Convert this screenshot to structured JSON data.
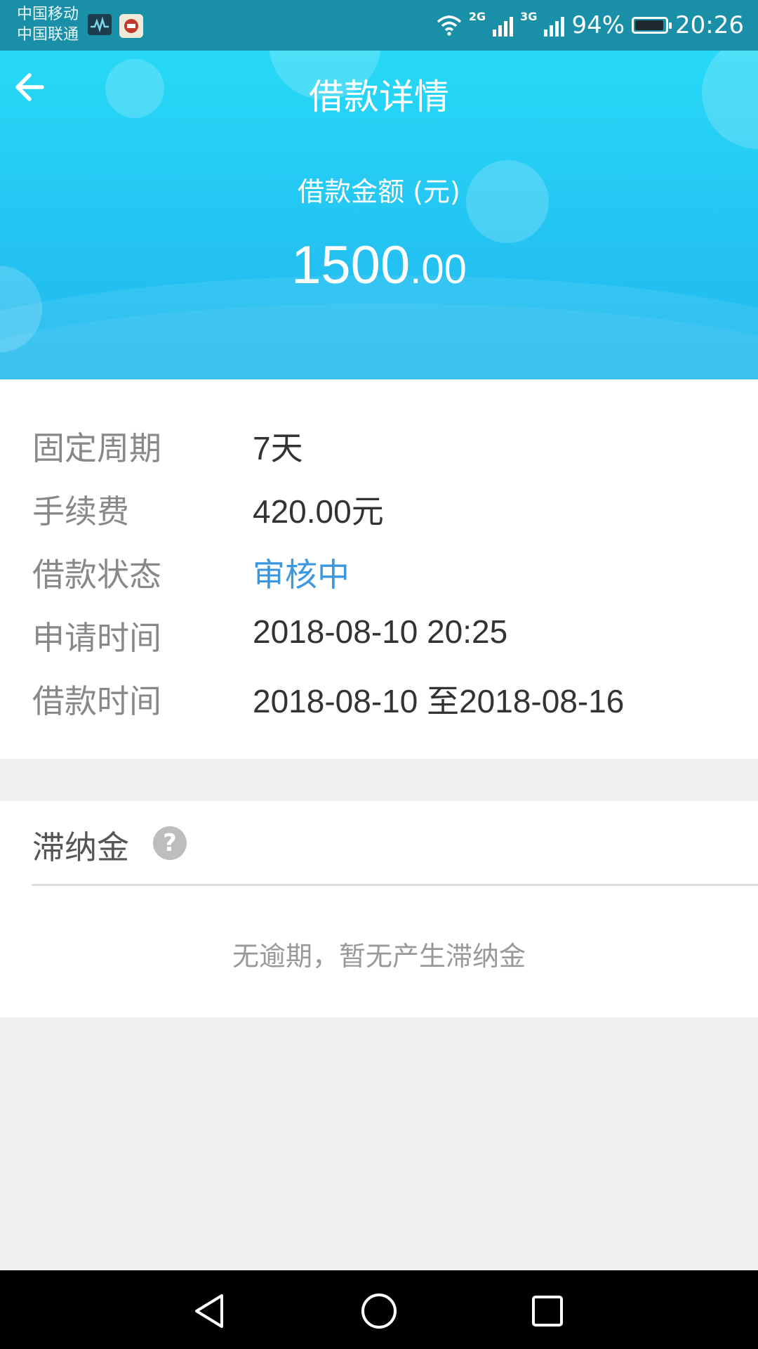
{
  "status_bar": {
    "carrier1": "中国移动",
    "carrier2": "中国联通",
    "net1": "2G",
    "net2": "3G",
    "battery": "94%",
    "time": "20:26"
  },
  "header": {
    "title": "借款详情",
    "amount_label": "借款金额 (元)",
    "amount_int": "1500",
    "amount_dec": ".00"
  },
  "details": [
    {
      "label": "固定周期",
      "value": "7天"
    },
    {
      "label": "手续费",
      "value": "420.00元"
    },
    {
      "label": "借款状态",
      "value": "审核中"
    },
    {
      "label": "申请时间",
      "value": "2018-08-10 20:25"
    },
    {
      "label": "借款时间",
      "value": "2018-08-10 至2018-08-16"
    }
  ],
  "late_fee": {
    "title": "滞纳金",
    "help_icon": "?",
    "message": "无逾期，暂无产生滞纳金"
  },
  "icons": {
    "back": "arrow-left-icon",
    "help": "question-circle-icon",
    "nav_back": "triangle-back-icon",
    "nav_home": "circle-home-icon",
    "nav_recent": "square-recent-icon"
  },
  "colors": {
    "header_gradient_top": "#27d9f6",
    "header_gradient_bottom": "#1fb8ee",
    "status_accent": "#3b97e0"
  }
}
